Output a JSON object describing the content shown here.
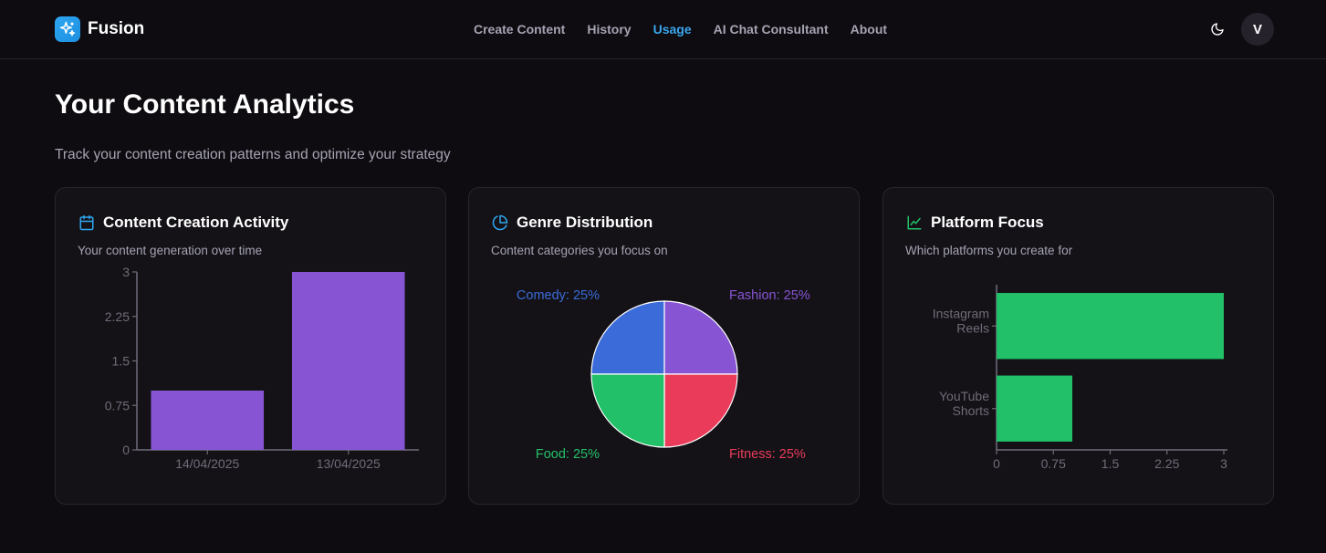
{
  "app": {
    "name": "Fusion",
    "logo_icon": "sparkles-icon",
    "brand_color": "#2ea7f2"
  },
  "nav": {
    "items": [
      {
        "label": "Create Content",
        "active": false
      },
      {
        "label": "History",
        "active": false
      },
      {
        "label": "Usage",
        "active": true
      },
      {
        "label": "AI Chat Consultant",
        "active": false
      },
      {
        "label": "About",
        "active": false
      }
    ],
    "active_color": "#3aa6ee"
  },
  "header_actions": {
    "theme_icon": "moon-icon",
    "avatar_initial": "V"
  },
  "page": {
    "title": "Your Content Analytics",
    "subtitle": "Track your content creation patterns and optimize your strategy"
  },
  "cards": [
    {
      "title": "Content Creation Activity",
      "subtitle": "Your content generation over time",
      "icon": "calendar-icon",
      "icon_color": "#2ea7f2"
    },
    {
      "title": "Genre Distribution",
      "subtitle": "Content categories you focus on",
      "icon": "pie-chart-icon",
      "icon_color": "#2ea7f2"
    },
    {
      "title": "Platform Focus",
      "subtitle": "Which platforms you create for",
      "icon": "line-chart-icon",
      "icon_color": "#22c068"
    }
  ],
  "chart_data": [
    {
      "type": "bar",
      "orientation": "vertical",
      "categories": [
        "14/04/2025",
        "13/04/2025"
      ],
      "values": [
        1,
        3
      ],
      "yticks": [
        "0",
        "0.75",
        "1.5",
        "2.25",
        "3"
      ],
      "ylim": [
        0,
        3
      ],
      "color": "#8755d3",
      "grid": false
    },
    {
      "type": "pie",
      "slices": [
        {
          "label": "Comedy",
          "value": 25,
          "display": "Comedy: 25%",
          "color": "#3a6bd8"
        },
        {
          "label": "Fashion",
          "value": 25,
          "display": "Fashion: 25%",
          "color": "#8755d3"
        },
        {
          "label": "Fitness",
          "value": 25,
          "display": "Fitness: 25%",
          "color": "#eb3b5a"
        },
        {
          "label": "Food",
          "value": 25,
          "display": "Food: 25%",
          "color": "#22c068"
        }
      ]
    },
    {
      "type": "bar",
      "orientation": "horizontal",
      "categories": [
        [
          "Instagram",
          "Reels"
        ],
        [
          "YouTube",
          "Shorts"
        ]
      ],
      "values": [
        3,
        1
      ],
      "xticks": [
        "0",
        "0.75",
        "1.5",
        "2.25",
        "3"
      ],
      "xlim": [
        0,
        3
      ],
      "color": "#22c068",
      "grid": false
    }
  ]
}
